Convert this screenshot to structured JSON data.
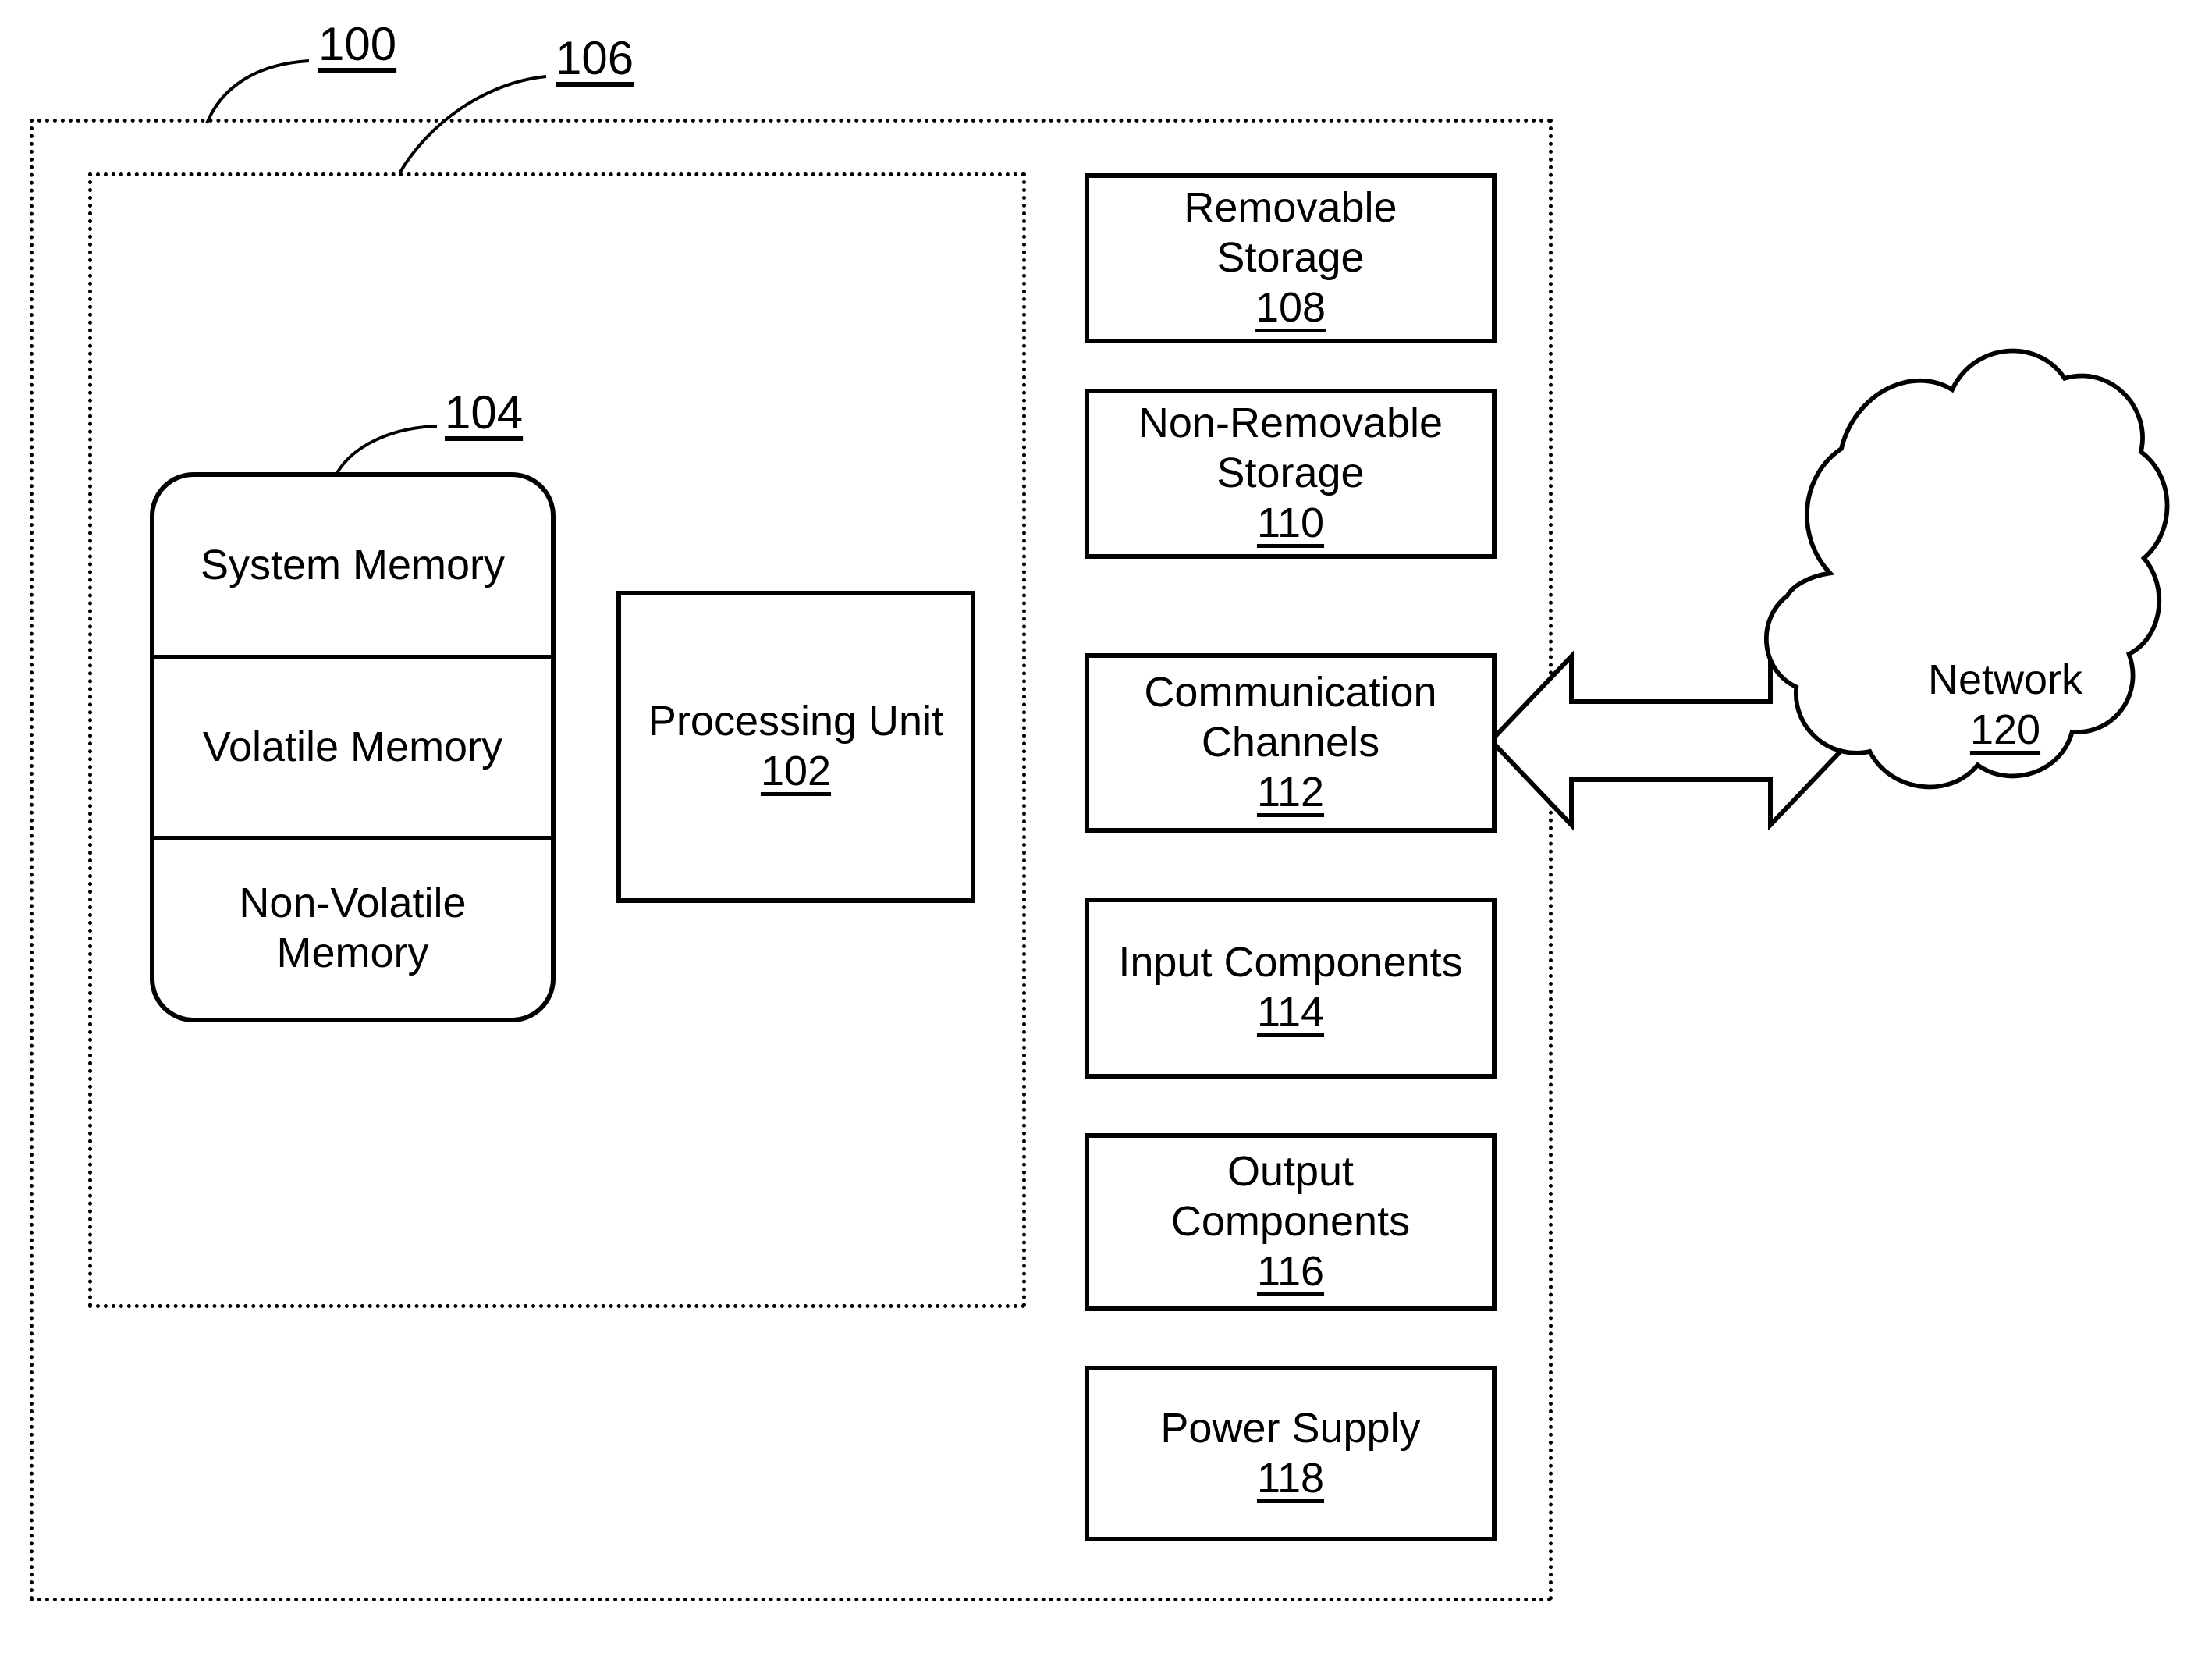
{
  "figure": {
    "type": "patent-block-diagram",
    "callouts": [
      {
        "id": "100",
        "label": "100"
      },
      {
        "id": "106",
        "label": "106"
      },
      {
        "id": "104",
        "label": "104"
      }
    ]
  },
  "enclosures": {
    "outer": {
      "ref": "100"
    },
    "inner": {
      "ref": "106"
    }
  },
  "memory_stack": {
    "ref": "104",
    "rows": [
      {
        "label": "System Memory"
      },
      {
        "label": "Volatile Memory"
      },
      {
        "label": "Non-Volatile\nMemory"
      }
    ]
  },
  "processing_unit": {
    "title": "Processing Unit",
    "refnum": "102"
  },
  "components": [
    {
      "title": "Removable\nStorage",
      "refnum": "108"
    },
    {
      "title": "Non-Removable\nStorage",
      "refnum": "110"
    },
    {
      "title": "Communication\nChannels",
      "refnum": "112"
    },
    {
      "title": "Input Components",
      "refnum": "114"
    },
    {
      "title": "Output\nComponents",
      "refnum": "116"
    },
    {
      "title": "Power Supply",
      "refnum": "118"
    }
  ],
  "network": {
    "title": "Network",
    "refnum": "120"
  },
  "connector": {
    "kind": "double-headed-arrow",
    "from": "Communication Channels",
    "to": "Network"
  },
  "colors": {
    "stroke": "#000000",
    "background": "#ffffff"
  }
}
